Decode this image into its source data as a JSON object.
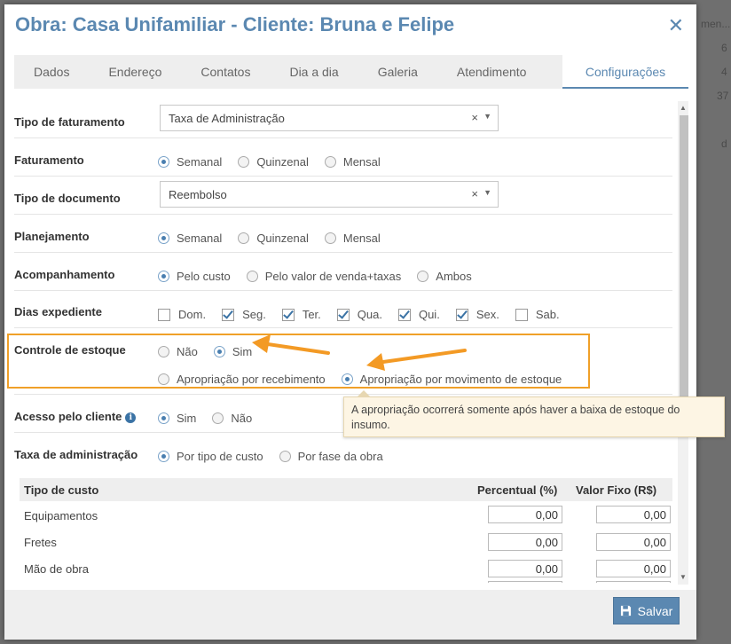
{
  "background": {
    "fragments": [
      "men...",
      "6",
      "4",
      "37",
      "d"
    ]
  },
  "modal": {
    "title": "Obra: Casa Unifamiliar - Cliente: Bruna e Felipe",
    "tabs": [
      "Dados",
      "Endereço",
      "Contatos",
      "Dia a dia",
      "Galeria",
      "Atendimento",
      "Configurações"
    ],
    "active_tab": "Configurações"
  },
  "form": {
    "tipo_faturamento": {
      "label": "Tipo de faturamento",
      "value": "Taxa de Administração"
    },
    "faturamento": {
      "label": "Faturamento",
      "options": [
        "Semanal",
        "Quinzenal",
        "Mensal"
      ],
      "selected": "Semanal"
    },
    "tipo_documento": {
      "label": "Tipo de documento",
      "value": "Reembolso"
    },
    "planejamento": {
      "label": "Planejamento",
      "options": [
        "Semanal",
        "Quinzenal",
        "Mensal"
      ],
      "selected": "Semanal"
    },
    "acompanhamento": {
      "label": "Acompanhamento",
      "options": [
        "Pelo custo",
        "Pelo valor de venda+taxas",
        "Ambos"
      ],
      "selected": "Pelo custo"
    },
    "dias_expediente": {
      "label": "Dias expediente",
      "days": [
        {
          "label": "Dom.",
          "checked": false
        },
        {
          "label": "Seg.",
          "checked": true
        },
        {
          "label": "Ter.",
          "checked": true
        },
        {
          "label": "Qua.",
          "checked": true
        },
        {
          "label": "Qui.",
          "checked": true
        },
        {
          "label": "Sex.",
          "checked": true
        },
        {
          "label": "Sab.",
          "checked": false
        }
      ]
    },
    "controle_estoque": {
      "label": "Controle de estoque",
      "options": [
        "Não",
        "Sim"
      ],
      "selected": "Sim",
      "apropriacao_options": [
        "Apropriação por recebimento",
        "Apropriação por movimento de estoque"
      ],
      "apropriacao_selected": "Apropriação por movimento de estoque"
    },
    "acesso_cliente": {
      "label": "Acesso pelo cliente",
      "options": [
        "Sim",
        "Não"
      ],
      "selected": "Sim"
    },
    "taxa_administracao": {
      "label": "Taxa de administração",
      "options": [
        "Por tipo de custo",
        "Por fase da obra"
      ],
      "selected": "Por tipo de custo"
    }
  },
  "tooltip": {
    "text": "A apropriação ocorrerá somente após haver a baixa de estoque do insumo."
  },
  "table": {
    "headers": [
      "Tipo de custo",
      "Percentual (%)",
      "Valor Fixo (R$)"
    ],
    "rows": [
      {
        "name": "Equipamentos",
        "percentual": "0,00",
        "valor_fixo": "0,00"
      },
      {
        "name": "Fretes",
        "percentual": "0,00",
        "valor_fixo": "0,00"
      },
      {
        "name": "Mão de obra",
        "percentual": "0,00",
        "valor_fixo": "0,00"
      }
    ]
  },
  "footer": {
    "save_label": "Salvar"
  },
  "colors": {
    "accent": "#5b88b1",
    "highlight": "#f0a028",
    "tooltip_bg": "#fdf5e4"
  }
}
